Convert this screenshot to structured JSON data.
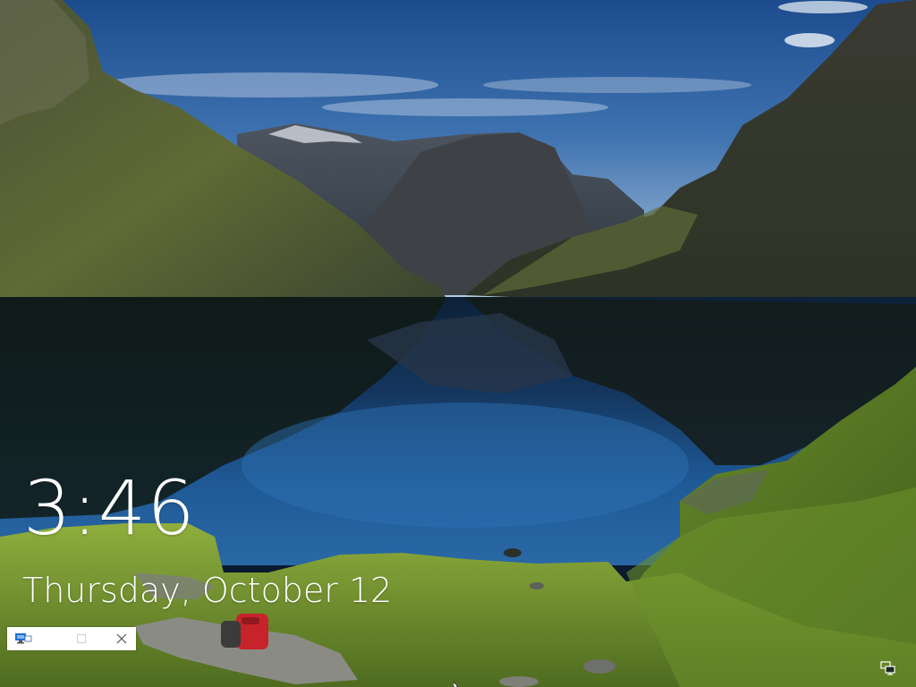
{
  "lock_screen": {
    "time": "3:46",
    "date": "Thursday, October 12"
  },
  "mini_window": {
    "icon": "remote-desktop-icon",
    "maximize_icon": "maximize-icon",
    "close_icon": "close-icon"
  },
  "tray": {
    "network_icon": "network-icon"
  },
  "colors": {
    "text": "#ffffff",
    "sky_top": "#1f4e92",
    "lake": "#1d5c9e",
    "grass": "#7ea235"
  }
}
